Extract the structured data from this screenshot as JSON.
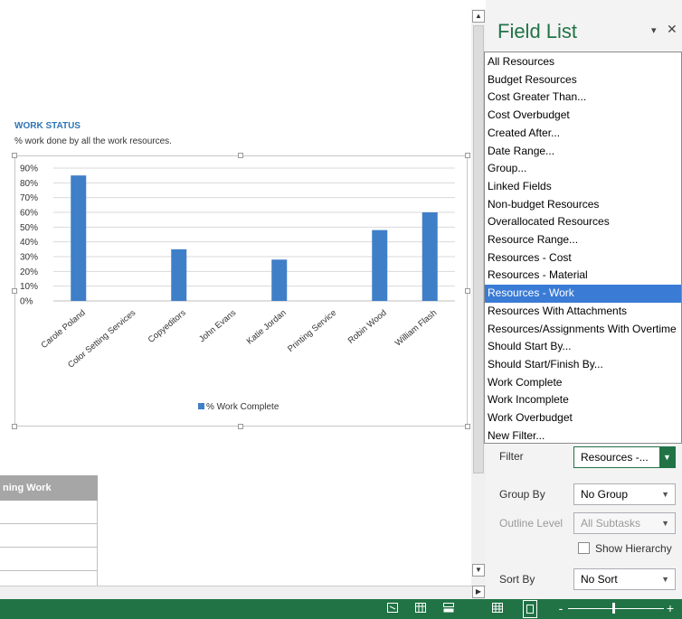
{
  "report": {
    "chart_title": "WORK STATUS",
    "chart_subtitle": "% work done by all the work resources.",
    "table_header": "ning Work"
  },
  "chart_data": {
    "type": "bar",
    "categories": [
      "Carole Poland",
      "Color Setting Services",
      "Copyeditors",
      "John Evans",
      "Katie Jordan",
      "Printing Service",
      "Robin Wood",
      "William Flash"
    ],
    "series": [
      {
        "name": "% Work Complete",
        "values": [
          85,
          0,
          35,
          0,
          28,
          0,
          48,
          60
        ]
      }
    ],
    "yticks": [
      "0%",
      "10%",
      "20%",
      "30%",
      "40%",
      "50%",
      "60%",
      "70%",
      "80%",
      "90%"
    ],
    "ylim": [
      0,
      90
    ],
    "grid": true,
    "legend": "bottom",
    "bar_color": "#3f7fc8"
  },
  "field_list": {
    "title": "Field List",
    "dropdown_icon": "▾",
    "close_icon": "✕"
  },
  "filter_menu": {
    "items": [
      "All Resources",
      "Budget Resources",
      "Cost Greater Than...",
      "Cost Overbudget",
      "Created After...",
      "Date Range...",
      "Group...",
      "Linked Fields",
      "Non-budget Resources",
      "Overallocated Resources",
      "Resource Range...",
      "Resources - Cost",
      "Resources - Material",
      "Resources - Work",
      "Resources With Attachments",
      "Resources/Assignments With Overtime",
      "Should Start By...",
      "Should Start/Finish By...",
      "Work Complete",
      "Work Incomplete",
      "Work Overbudget",
      "New Filter..."
    ],
    "selected": "Resources - Work"
  },
  "options": {
    "filter_label": "Filter",
    "filter_value": "Resources -...",
    "group_by_label": "Group By",
    "group_by_value": "No Group",
    "outline_level_label": "Outline Level",
    "outline_level_value": "All Subtasks",
    "show_hierarchy_label": "Show Hierarchy",
    "sort_by_label": "Sort By",
    "sort_by_value": "No Sort"
  },
  "statusbar": {
    "zoom_minus": "-",
    "zoom_plus": "+"
  }
}
